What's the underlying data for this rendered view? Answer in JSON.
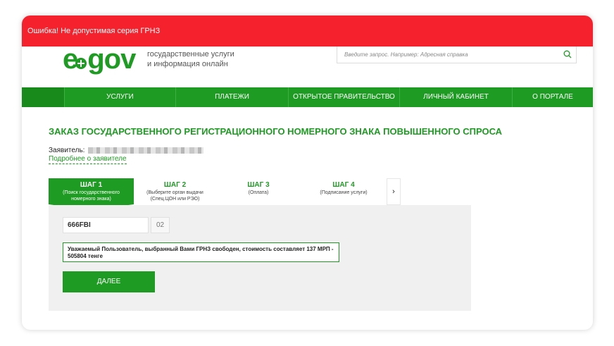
{
  "error": {
    "text": "Ошибка! Не допустимая серия ГРНЗ"
  },
  "header": {
    "logo_e": "e",
    "logo_gov": "gov",
    "tagline_line1": "государственные услуги",
    "tagline_line2": "и информация онлайн",
    "search_placeholder": "Введите запрос. Например: Адресная справка"
  },
  "nav": {
    "items": [
      {
        "label": "Услуги"
      },
      {
        "label": "Платежи"
      },
      {
        "label": "Открытое правительство"
      },
      {
        "label": "Личный кабинет"
      },
      {
        "label": "О портале"
      }
    ]
  },
  "main": {
    "title": "ЗАКАЗ ГОСУДАРСТВЕННОГО РЕГИСТРАЦИОННОГО НОМЕРНОГО ЗНАКА ПОВЫШЕННОГО СПРОСА",
    "applicant_label": "Заявитель:",
    "applicant_link": "Подробнее о заявителе"
  },
  "steps": [
    {
      "title": "ШАГ 1",
      "subtitle_line1": "(Поиск государственного",
      "subtitle_line2": "номерного знака)"
    },
    {
      "title": "ШАГ 2",
      "subtitle_line1": "(Выберите орган выдачи",
      "subtitle_line2": "(Спец.ЦОН или РЭО)"
    },
    {
      "title": "ШАГ 3",
      "subtitle_line1": "(Оплата)",
      "subtitle_line2": ""
    },
    {
      "title": "ШАГ 4",
      "subtitle_line1": "(Подписание услуги)",
      "subtitle_line2": ""
    }
  ],
  "form": {
    "plate_value": "666FBI",
    "region_value": "02",
    "notice": "Уважаемый Пользователь, выбранный Вами ГРНЗ свободен, стоимость составляет 137 МРП - 505804 тенге",
    "next_button": "ДАЛЕЕ"
  },
  "colors": {
    "accent": "#1e9b22",
    "error": "#f5222d"
  }
}
